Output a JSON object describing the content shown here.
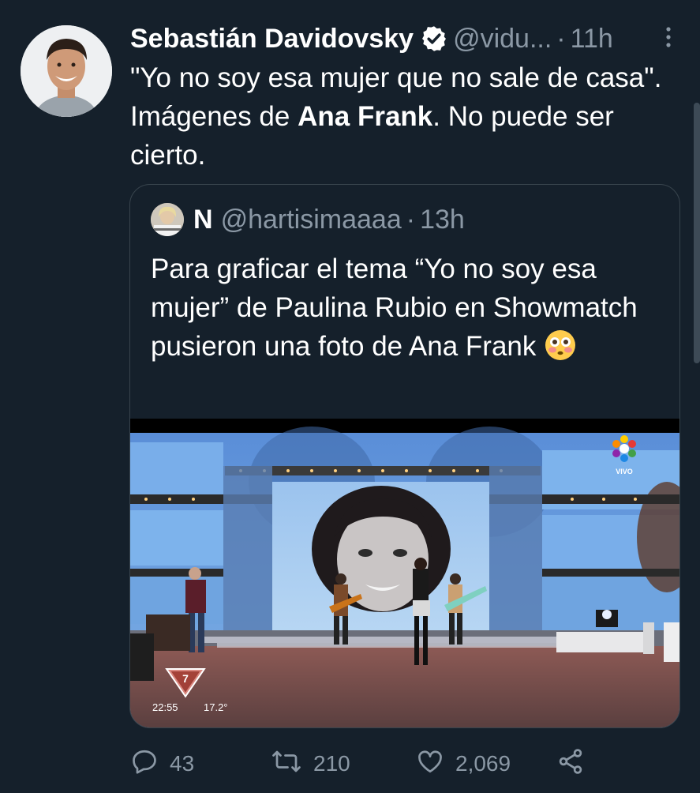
{
  "tweet": {
    "author_name": "Sebastián Davidovsky",
    "handle": "@vidu...",
    "separator": "·",
    "time": "11h",
    "text_part1": "\"Yo no soy esa mujer que no sale de casa\". Imágenes de ",
    "text_bold": "Ana Frank",
    "text_part2": ". No puede ser cierto."
  },
  "quoted_tweet": {
    "name": "N",
    "handle": "@hartisimaaaa",
    "separator": "·",
    "time": "13h",
    "text": "Para graficar el tema “Yo no soy esa mujer” de Paulina Rubio en Showmatch pusieron una foto de Ana Frank",
    "emoji": "flushed-face-emoji",
    "media": {
      "tv_clock": "22:55",
      "tv_temperature": "17.2°",
      "live_label": "VIVO"
    }
  },
  "actions": {
    "replies": "43",
    "retweets": "210",
    "likes": "2,069"
  },
  "colors": {
    "background": "#15202b",
    "secondary_text": "#8b98a5",
    "border": "#38444d"
  },
  "icons": [
    "verified-badge-icon",
    "more-options-icon",
    "reply-icon",
    "retweet-icon",
    "like-icon",
    "share-icon"
  ]
}
